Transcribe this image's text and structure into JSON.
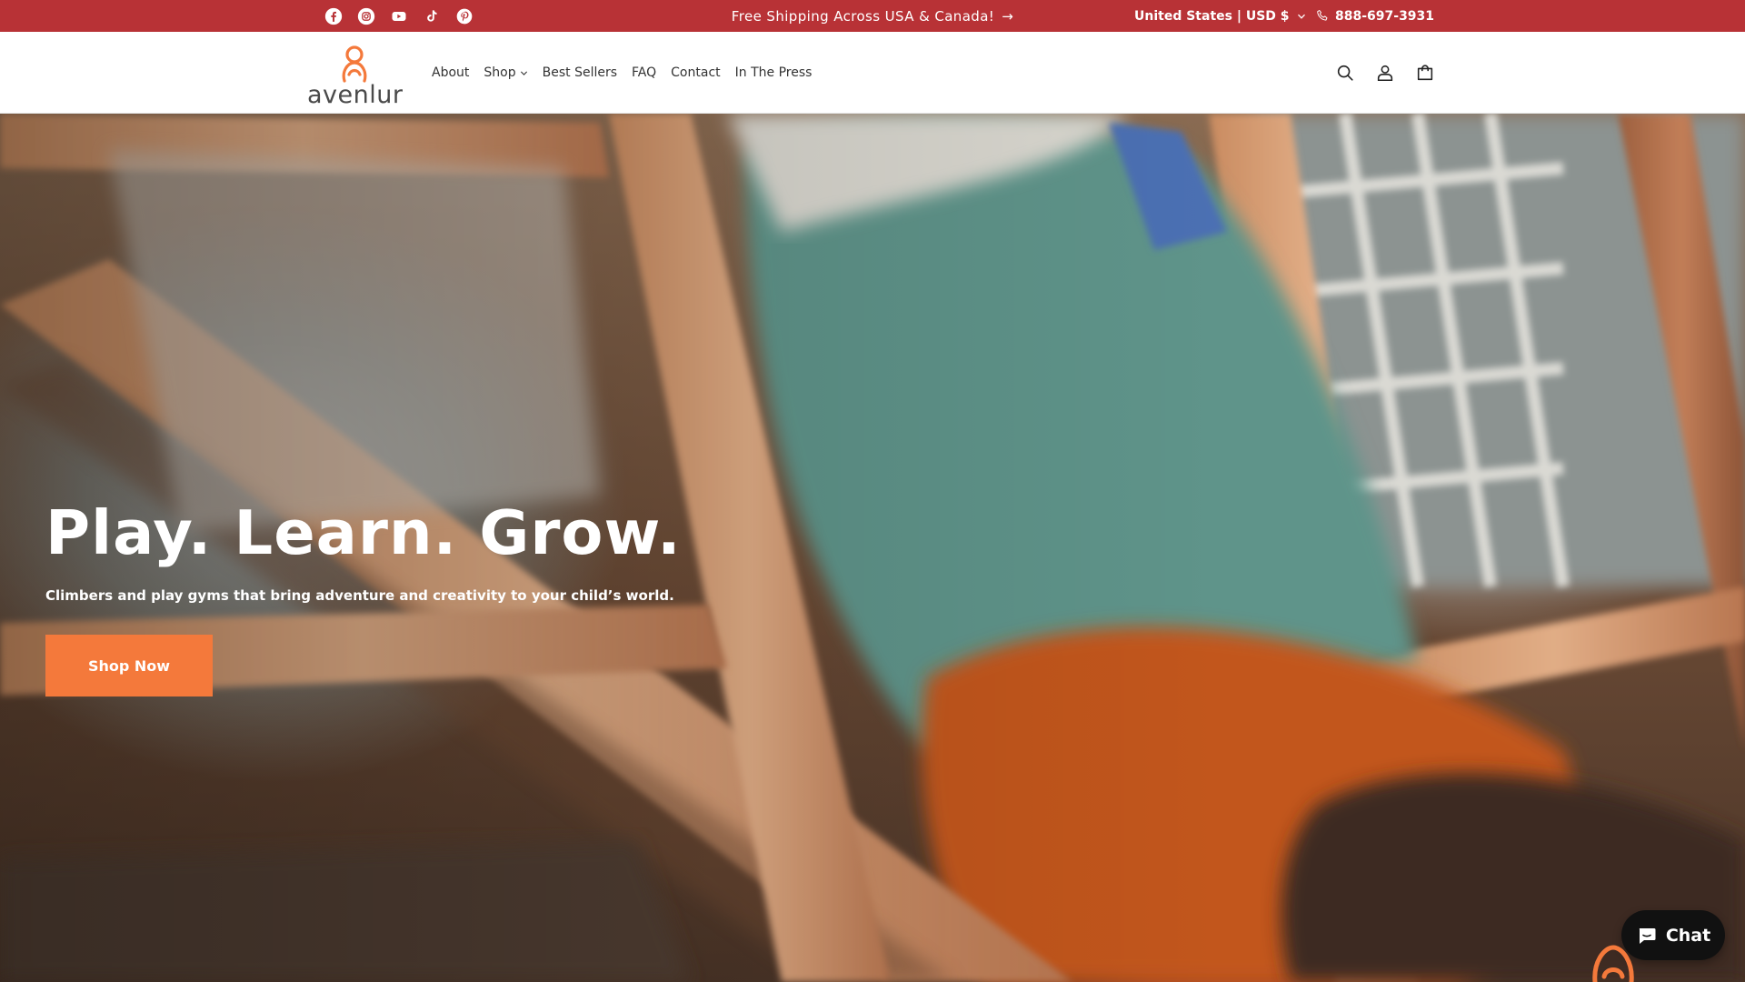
{
  "topbar": {
    "social": [
      {
        "name": "facebook-icon"
      },
      {
        "name": "instagram-icon"
      },
      {
        "name": "youtube-icon"
      },
      {
        "name": "tiktok-icon"
      },
      {
        "name": "pinterest-icon"
      }
    ],
    "announcement": "Free Shipping Across USA & Canada!",
    "announcement_arrow": "→",
    "locale": "United States | USD $",
    "phone": "888-697-3931",
    "background_color": "#b83236"
  },
  "header": {
    "logo_text": "avenlur",
    "nav": [
      {
        "label": "About"
      },
      {
        "label": "Shop",
        "has_dropdown": true
      },
      {
        "label": "Best Sellers"
      },
      {
        "label": "FAQ"
      },
      {
        "label": "Contact"
      },
      {
        "label": "In The Press"
      }
    ],
    "icons": [
      "search-icon",
      "account-icon",
      "cart-icon"
    ],
    "brand_color": "#f4793b"
  },
  "hero": {
    "title": "Play. Learn. Grow.",
    "subtitle": "Climbers and play gyms that bring adventure and creativity to your child’s world.",
    "cta_label": "Shop Now",
    "cta_color": "#f4793b"
  },
  "chat": {
    "label": "Chat"
  }
}
